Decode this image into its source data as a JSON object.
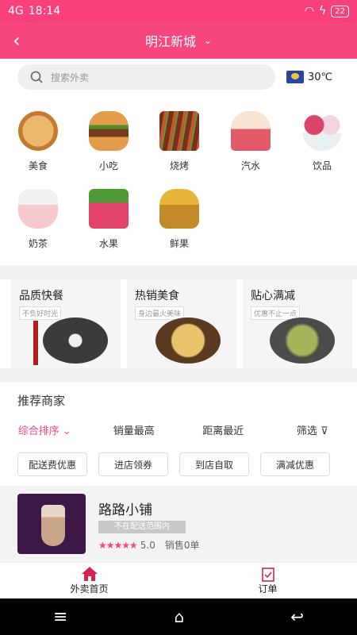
{
  "status": {
    "time": "18:14",
    "signal": "4G",
    "battery": "22"
  },
  "header": {
    "title": "明江新城"
  },
  "search": {
    "placeholder": "搜索外卖"
  },
  "weather": {
    "temp": "30℃"
  },
  "categories": [
    "美食",
    "小吃",
    "烧烤",
    "汽水",
    "饮品",
    "奶茶",
    "水果",
    "鲜果"
  ],
  "promos": [
    {
      "title": "品质快餐",
      "sub": "不负好时光"
    },
    {
      "title": "热销美食",
      "sub": "身边最火美味"
    },
    {
      "title": "贴心满减",
      "sub": "优惠不止一点"
    }
  ],
  "recommend": {
    "title": "推荐商家"
  },
  "sort": [
    "综合排序",
    "销量最高",
    "距离最近",
    "筛选"
  ],
  "filters": [
    "配送费优惠",
    "进店领券",
    "到店自取",
    "满减优惠"
  ],
  "shop": {
    "name": "路路小铺",
    "status": "不在配送范围内",
    "rating_stars": "★★★★★",
    "score": "5.0",
    "sales": "销售0单"
  },
  "tabs": [
    "外卖首页",
    "订单"
  ],
  "colors": {
    "accent": "#f7457e"
  }
}
